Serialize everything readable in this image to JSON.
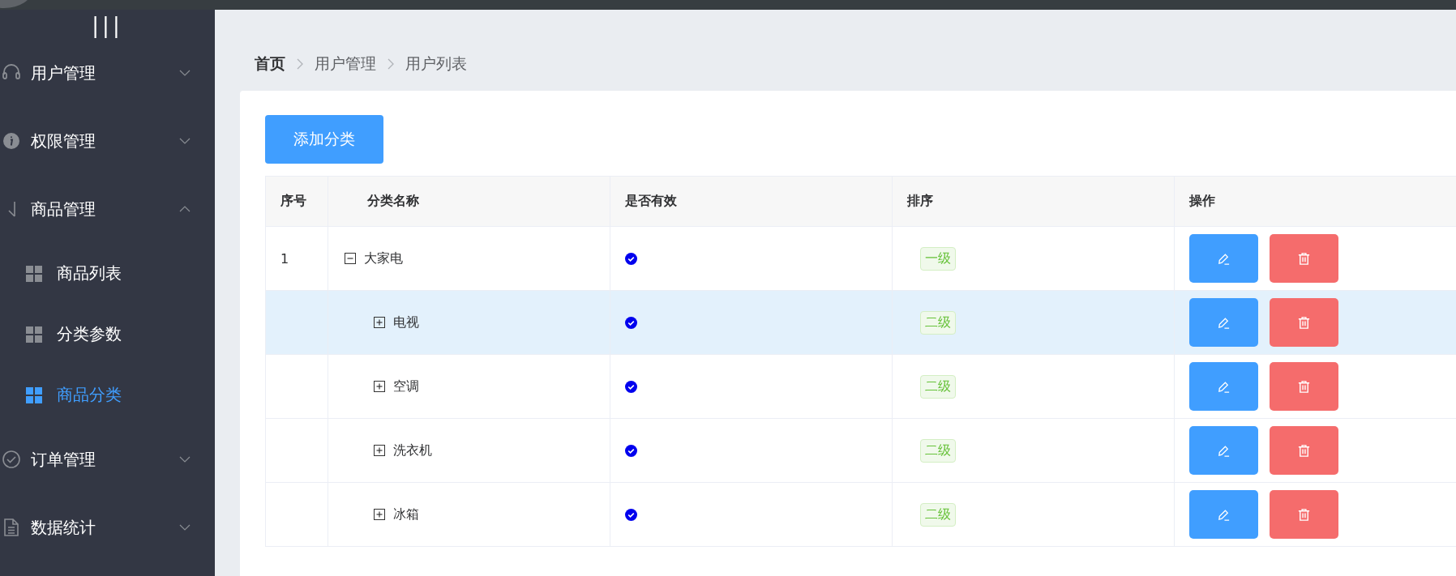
{
  "sidebar": {
    "toggle": "|||",
    "menus": [
      {
        "label": "用户管理",
        "expanded": false
      },
      {
        "label": "权限管理",
        "expanded": false
      },
      {
        "label": "商品管理",
        "expanded": true,
        "children": [
          {
            "label": "商品列表",
            "selected": false
          },
          {
            "label": "分类参数",
            "selected": false
          },
          {
            "label": "商品分类",
            "selected": true
          }
        ]
      },
      {
        "label": "订单管理",
        "expanded": false
      },
      {
        "label": "数据统计",
        "expanded": false
      }
    ]
  },
  "breadcrumb": [
    "首页",
    "用户管理",
    "用户列表"
  ],
  "add_button": "添加分类",
  "table": {
    "columns": [
      "序号",
      "分类名称",
      "是否有效",
      "排序",
      "操作"
    ],
    "rows": [
      {
        "index": "1",
        "name": "大家电",
        "valid": true,
        "level": "一级",
        "expanded": true,
        "selected": false,
        "children": [
          {
            "name": "电视",
            "valid": true,
            "level": "二级",
            "expanded": false,
            "selected": true
          },
          {
            "name": "空调",
            "valid": true,
            "level": "二级",
            "expanded": false,
            "selected": false
          },
          {
            "name": "洗衣机",
            "valid": true,
            "level": "二级",
            "expanded": false,
            "selected": false
          },
          {
            "name": "冰箱",
            "valid": true,
            "level": "二级",
            "expanded": false,
            "selected": false
          }
        ]
      }
    ]
  }
}
